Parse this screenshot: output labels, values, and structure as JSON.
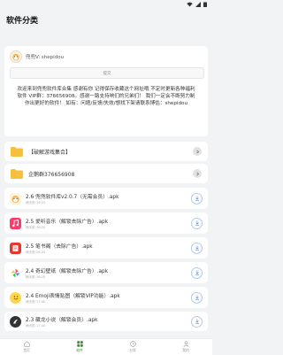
{
  "header": {
    "title": "软件分类"
  },
  "profile": {
    "name": "兜兜V: shepidou",
    "send_label": "提交"
  },
  "notice": "欢迎来到兜兜软件库合集 感谢有你 记得保存收藏这个网址哦 不定时更新各种福利软件 VIP群：376656908。感谢一路支持响们的兄弟们！ 我们一定会不断努力制作出更好的软件！ 如有：问题/反馈/失效/想找下架请联系博估：shepidou",
  "folders": [
    {
      "label": "【破解游戏集合】"
    },
    {
      "label": "企鹅群376656908"
    }
  ],
  "files": [
    {
      "name": "2.6 兜兜软件库v2.0.7（无需会员）.apk",
      "date": "两天前 16:25",
      "icon": "shiba-icon",
      "color": "#fff5df"
    },
    {
      "name": "2.5 爱听音乐（解锁去除广告）.apk",
      "date": "两天前 16:25",
      "icon": "music-icon",
      "color": "#ff3b6b"
    },
    {
      "name": "2.5 笔书阁（去除广告）.apk",
      "date": "两天前 16:25",
      "icon": "book-icon",
      "color": "#e8362f"
    },
    {
      "name": "2.4 奇幻壁纸（解锁去除广告）.apk",
      "date": "两天前 16:25",
      "icon": "pinwheel-icon",
      "color": "#ffffff"
    },
    {
      "name": "2.4 Emoji表情贴图（解锁VIP功能）.apk",
      "date": "两天前 17:40",
      "icon": "emoji-icon",
      "color": "#ffd54a"
    },
    {
      "name": "2.3 藏龙小说（解锁会员）.apk",
      "date": "两天前 17:40",
      "icon": "novel-icon",
      "color": "#333333"
    }
  ],
  "nav": [
    {
      "label": "首页",
      "icon": "home-icon"
    },
    {
      "label": "软件",
      "icon": "apps-icon"
    },
    {
      "label": "分类",
      "icon": "category-icon"
    },
    {
      "label": "我的",
      "icon": "profile-icon"
    }
  ],
  "colors": {
    "accent": "#3a8f2e",
    "folder": "#f7c03a",
    "download": "#6d8fd6"
  }
}
